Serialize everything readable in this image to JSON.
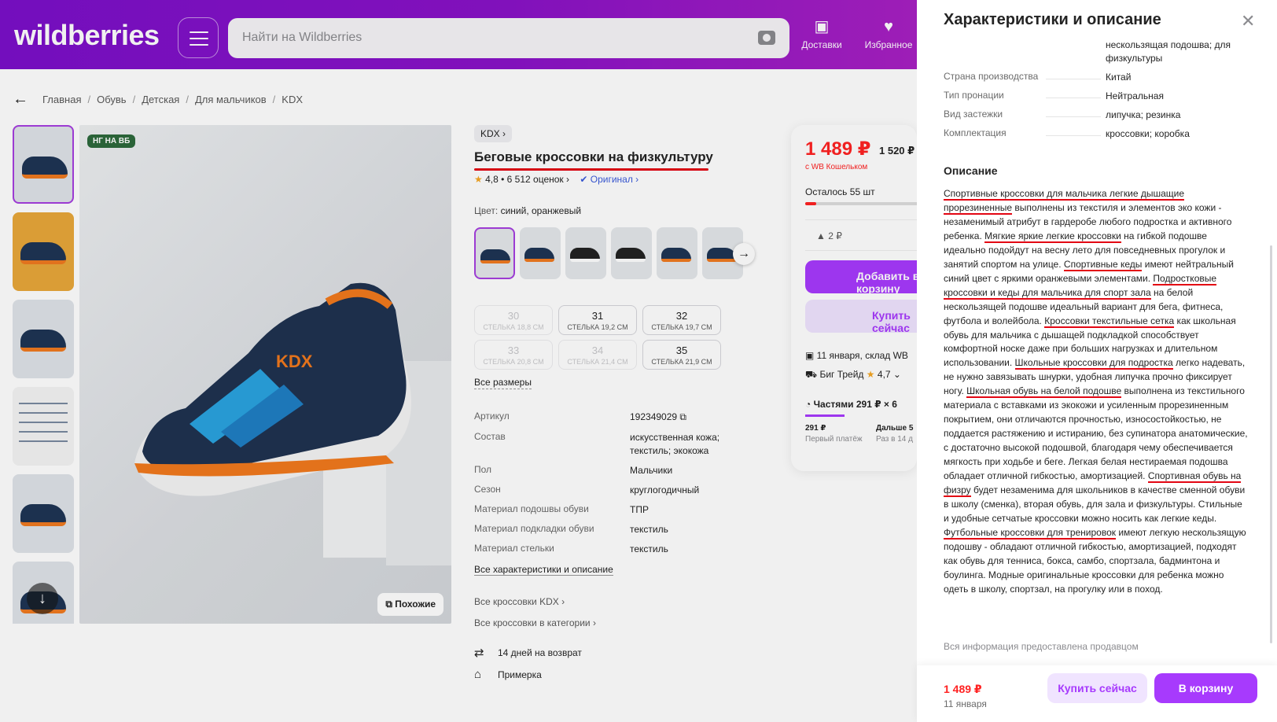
{
  "header": {
    "logo": "wildberries",
    "search_placeholder": "Найти на Wildberries",
    "nav": [
      {
        "label": "Доставки",
        "icon": "box-icon"
      },
      {
        "label": "Избранное",
        "icon": "heart-icon"
      }
    ]
  },
  "breadcrumbs": [
    "Главная",
    "Обувь",
    "Детская",
    "Для мальчиков",
    "KDX"
  ],
  "gallery": {
    "badge": "НГ НА ВБ",
    "similar_label": "Похожие"
  },
  "product": {
    "brand": "KDX",
    "title": "Беговые кроссовки на физкультуру",
    "rating": "4,8",
    "reviews": "6 512 оценок",
    "original": "Оригинал",
    "color_label": "Цвет:",
    "color_value": "синий, оранжевый",
    "sizes": [
      {
        "num": "30",
        "cm": "СТЕЛЬКА 18,8 СМ",
        "available": false
      },
      {
        "num": "31",
        "cm": "СТЕЛЬКА 19,2 СМ",
        "available": true
      },
      {
        "num": "32",
        "cm": "СТЕЛЬКА 19,7 СМ",
        "available": true
      },
      {
        "num": "33",
        "cm": "СТЕЛЬКА 20,8 СМ",
        "available": false
      },
      {
        "num": "34",
        "cm": "СТЕЛЬКА 21,4 СМ",
        "available": false
      },
      {
        "num": "35",
        "cm": "СТЕЛЬКА 21,9 СМ",
        "available": true
      }
    ],
    "all_sizes": "Все размеры",
    "specs": [
      {
        "k": "Артикул",
        "v": "192349029"
      },
      {
        "k": "Состав",
        "v": "искусственная кожа; текстиль; экокожа"
      },
      {
        "k": "Пол",
        "v": "Мальчики"
      },
      {
        "k": "Сезон",
        "v": "круглогодичный"
      },
      {
        "k": "Материал подошвы обуви",
        "v": "ТПР"
      },
      {
        "k": "Материал подкладки обуви",
        "v": "текстиль"
      },
      {
        "k": "Материал стельки",
        "v": "текстиль"
      }
    ],
    "all_chars": "Все характеристики и описание",
    "all_brand": "Все кроссовки KDX",
    "all_cat": "Все кроссовки в категории",
    "return": "14 дней на возврат",
    "fitting": "Примерка"
  },
  "price_box": {
    "price": "1 489 ₽",
    "old_price": "1 520 ₽",
    "wallet": "с WB Кошельком",
    "left": "Осталось 55 шт",
    "points": "2 ₽",
    "add": "Добавить в корзину",
    "buy": "Купить сейчас",
    "delivery": "11 января, склад WB",
    "seller": "Биг Трейд",
    "seller_rating": "4,7",
    "parts": "Частями 291 ₽ × 6",
    "part1": "291 ₽",
    "part1_sub": "Первый платёж",
    "part2": "Дальше 5",
    "part2_sub": "Раз в 14 д"
  },
  "panel": {
    "title": "Характеристики и описание",
    "rows": [
      {
        "k": "",
        "v": "нескользящая подошва; для физкультуры"
      },
      {
        "k": "Страна производства",
        "v": "Китай"
      },
      {
        "k": "Тип пронации",
        "v": "Нейтральная"
      },
      {
        "k": "Вид застежки",
        "v": "липучка; резинка"
      },
      {
        "k": "Комплектация",
        "v": "кроссовки; коробка"
      }
    ],
    "desc_heading": "Описание",
    "note": "Вся информация предоставлена продавцом",
    "bottom_price": "1 489 ₽",
    "bottom_date": "11 января",
    "bottom_buy": "Купить сейчас",
    "bottom_cart": "В корзину"
  }
}
